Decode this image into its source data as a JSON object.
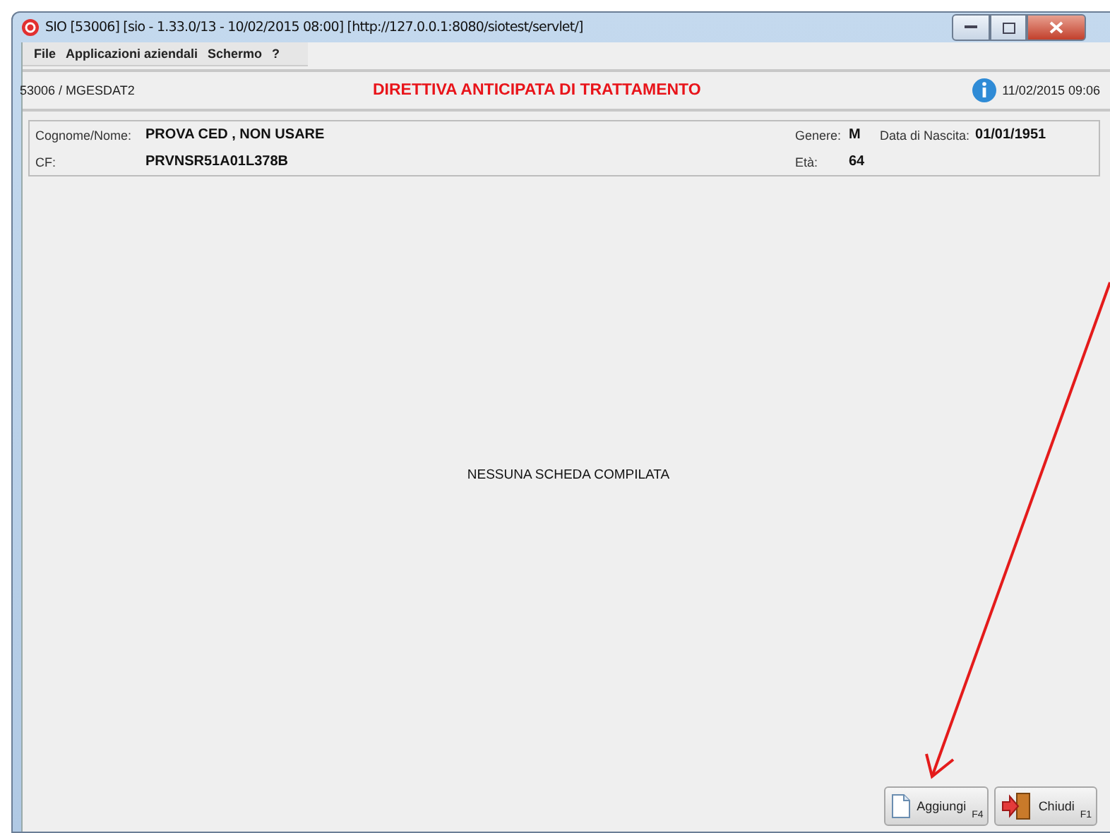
{
  "window": {
    "title": "SIO [53006] [sio - 1.33.0/13 - 10/02/2015 08:00] [http://127.0.0.1:8080/siotest/servlet/]"
  },
  "menu": [
    "File",
    "Applicazioni aziendali",
    "Schermo",
    "?"
  ],
  "header": {
    "code": "53006 / MGESDAT2",
    "title": "DIRETTIVA ANTICIPATA DI TRATTAMENTO",
    "datetime": "11/02/2015 09:06"
  },
  "patient": [
    {
      "label": "Cognome/Nome:",
      "value": "PROVA CED , NON USARE"
    },
    {
      "label": "Genere:",
      "value": "M"
    },
    {
      "label": "Data di Nascita:",
      "value": "01/01/1951"
    },
    {
      "label": "CF:",
      "value": "PRVNSR51A01L378B"
    },
    {
      "label": "Età:",
      "value": "64"
    }
  ],
  "message": "NESSUNA SCHEDA COMPILATA",
  "buttons": [
    {
      "kind": "add",
      "label": "Aggiungi",
      "key": "F4"
    },
    {
      "kind": "close",
      "label": "Chiudi",
      "key": "F1"
    }
  ]
}
